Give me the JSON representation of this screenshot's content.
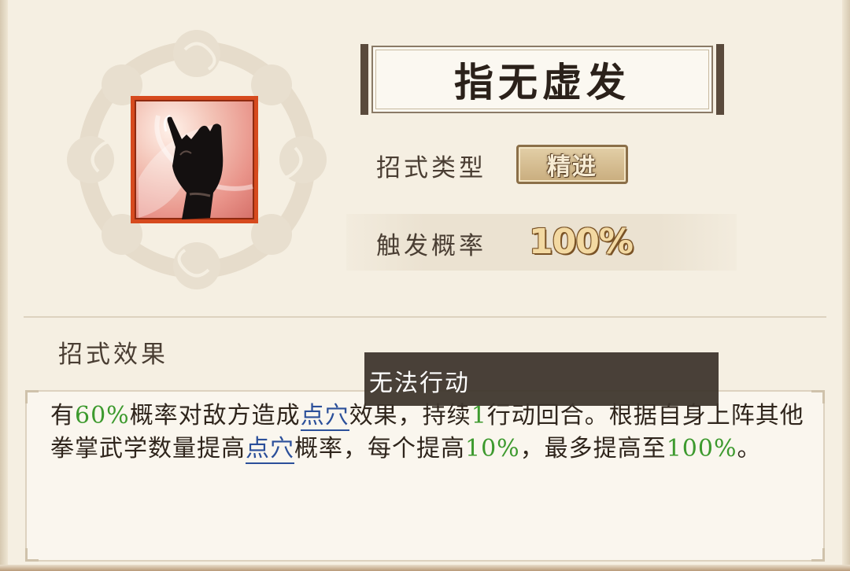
{
  "skill": {
    "icon": "pointing-hand-icon",
    "name": "指无虚发",
    "type_label": "招式类型",
    "type_value": "精进",
    "rate_label": "触发概率",
    "rate_value": "100%"
  },
  "effects": {
    "heading": "招式效果",
    "segments": {
      "s1": "有",
      "s2": "60%",
      "s3": "概率对敌方造成",
      "s4": "点穴",
      "s5": "效果，持续",
      "s6": "1",
      "s7": "行动回合。根据自身上阵其他拳掌武学数量提高",
      "s8": "点穴",
      "s9": "概率，每个提高",
      "s10": "10%",
      "s11": "，最多提高至",
      "s12": "100%",
      "s13": "。"
    }
  },
  "tooltip": {
    "text": "无法行动"
  },
  "colors": {
    "highlight_green": "#3d9a2e",
    "link_blue": "#2b4f9a",
    "icon_border": "#d64a1e",
    "tooltip_bg": "#3e352d"
  }
}
